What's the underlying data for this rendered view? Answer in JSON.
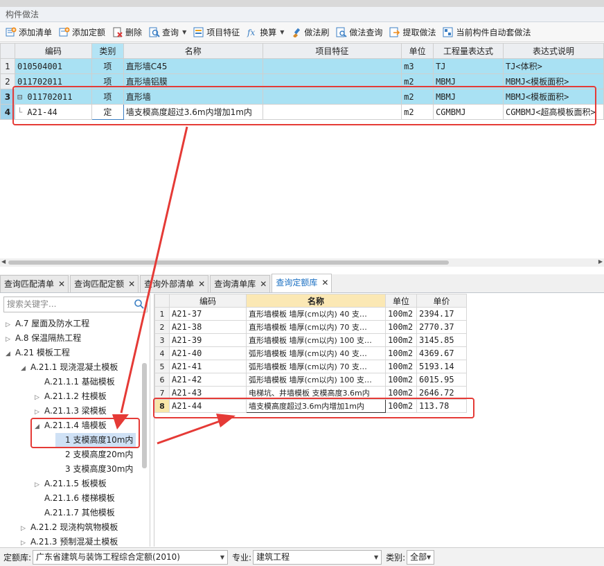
{
  "panel_title": "构件做法",
  "toolbar": [
    {
      "label": "添加清单",
      "icon": "add-list-icon",
      "caret": false
    },
    {
      "label": "添加定额",
      "icon": "add-quota-icon",
      "caret": false
    },
    {
      "label": "删除",
      "icon": "delete-icon",
      "caret": false
    },
    {
      "label": "查询",
      "icon": "query-icon",
      "caret": true
    },
    {
      "label": "项目特征",
      "icon": "feature-icon",
      "caret": false
    },
    {
      "label": "换算",
      "icon": "fx-icon",
      "caret": true
    },
    {
      "label": "做法刷",
      "icon": "brush-icon",
      "caret": false
    },
    {
      "label": "做法查询",
      "icon": "method-query-icon",
      "caret": false
    },
    {
      "label": "提取做法",
      "icon": "extract-icon",
      "caret": false
    },
    {
      "label": "当前构件自动套做法",
      "icon": "auto-apply-icon",
      "caret": false
    }
  ],
  "top_grid": {
    "headers": [
      "编码",
      "类别",
      "名称",
      "项目特征",
      "单位",
      "工程量表达式",
      "表达式说明"
    ],
    "rows": [
      {
        "no": "1",
        "code": "010504001",
        "type": "项",
        "name": "直形墙C45",
        "feature": "",
        "unit": "m3",
        "expr": "TJ",
        "desc": "TJ<体积>"
      },
      {
        "no": "2",
        "code": "011702011",
        "type": "项",
        "name": "直形墙铝膜",
        "feature": "",
        "unit": "m2",
        "expr": "MBMJ",
        "desc": "MBMJ<模板面积>"
      },
      {
        "no": "3",
        "code": "011702011",
        "type": "项",
        "name": "直形墙",
        "feature": "",
        "unit": "m2",
        "expr": "MBMJ",
        "desc": "MBMJ<模板面积>"
      },
      {
        "no": "4",
        "code": "A21-44",
        "type": "定",
        "name": "墙支模高度超过3.6m内增加1m内",
        "feature": "",
        "unit": "m2",
        "expr": "CGMBMJ",
        "desc": "CGMBMJ<超高模板面积>"
      }
    ]
  },
  "tabs": [
    {
      "label": "查询匹配清单",
      "active": false
    },
    {
      "label": "查询匹配定额",
      "active": false
    },
    {
      "label": "查询外部清单",
      "active": false
    },
    {
      "label": "查询清单库",
      "active": false
    },
    {
      "label": "查询定额库",
      "active": true
    }
  ],
  "search": {
    "placeholder": "搜索关键字..."
  },
  "tree": [
    {
      "label": "A.7 屋面及防水工程",
      "arrow": "▷",
      "level": 0
    },
    {
      "label": "A.8 保温隔热工程",
      "arrow": "▷",
      "level": 0
    },
    {
      "label": "A.21 模板工程",
      "arrow": "◢",
      "level": 0
    },
    {
      "label": "A.21.1 现浇混凝土模板",
      "arrow": "◢",
      "level": 1
    },
    {
      "label": "A.21.1.1 基础模板",
      "arrow": "",
      "level": 2
    },
    {
      "label": "A.21.1.2 柱模板",
      "arrow": "▷",
      "level": 2
    },
    {
      "label": "A.21.1.3 梁模板",
      "arrow": "▷",
      "level": 2
    },
    {
      "label": "A.21.1.4 墙模板",
      "arrow": "◢",
      "level": 2
    },
    {
      "label": "1 支模高度10m内",
      "arrow": "",
      "level": 3,
      "selected": true
    },
    {
      "label": "2 支模高度20m内",
      "arrow": "",
      "level": 3
    },
    {
      "label": "3 支模高度30m内",
      "arrow": "",
      "level": 3
    },
    {
      "label": "A.21.1.5 板模板",
      "arrow": "▷",
      "level": 2
    },
    {
      "label": "A.21.1.6 楼梯模板",
      "arrow": "",
      "level": 2
    },
    {
      "label": "A.21.1.7 其他模板",
      "arrow": "",
      "level": 2
    },
    {
      "label": "A.21.2 现浇构筑物模板",
      "arrow": "▷",
      "level": 1
    },
    {
      "label": "A.21.3 预制混凝土模板",
      "arrow": "▷",
      "level": 1
    }
  ],
  "quota_grid": {
    "headers": [
      "编码",
      "名称",
      "单位",
      "单价"
    ],
    "rows": [
      {
        "no": "1",
        "code": "A21-37",
        "name": "直形墙模板 墙厚(cm以内) 40 支…",
        "unit": "100m2",
        "price": "2394.17"
      },
      {
        "no": "2",
        "code": "A21-38",
        "name": "直形墙模板 墙厚(cm以内) 70 支…",
        "unit": "100m2",
        "price": "2770.37"
      },
      {
        "no": "3",
        "code": "A21-39",
        "name": "直形墙模板 墙厚(cm以内) 100 支…",
        "unit": "100m2",
        "price": "3145.85"
      },
      {
        "no": "4",
        "code": "A21-40",
        "name": "弧形墙模板 墙厚(cm以内) 40 支…",
        "unit": "100m2",
        "price": "4369.67"
      },
      {
        "no": "5",
        "code": "A21-41",
        "name": "弧形墙模板 墙厚(cm以内) 70 支…",
        "unit": "100m2",
        "price": "5193.14"
      },
      {
        "no": "6",
        "code": "A21-42",
        "name": "弧形墙模板 墙厚(cm以内) 100 支…",
        "unit": "100m2",
        "price": "6015.95"
      },
      {
        "no": "7",
        "code": "A21-43",
        "name": "电梯坑、井墙模板 支模高度3.6m内",
        "unit": "100m2",
        "price": "2646.72"
      },
      {
        "no": "8",
        "code": "A21-44",
        "name": "墙支模高度超过3.6m内增加1m内",
        "unit": "100m2",
        "price": "113.78"
      }
    ]
  },
  "statusbar": {
    "quota_label": "定额库:",
    "quota_value": "广东省建筑与装饰工程综合定额(2010)",
    "major_label": "专业:",
    "major_value": "建筑工程",
    "category_label": "类别:",
    "category_value": "全部"
  },
  "colors": {
    "annotation": "#e53a36",
    "selected_row": "#a9e1f3",
    "active_tab_text": "#1a6fc2"
  }
}
